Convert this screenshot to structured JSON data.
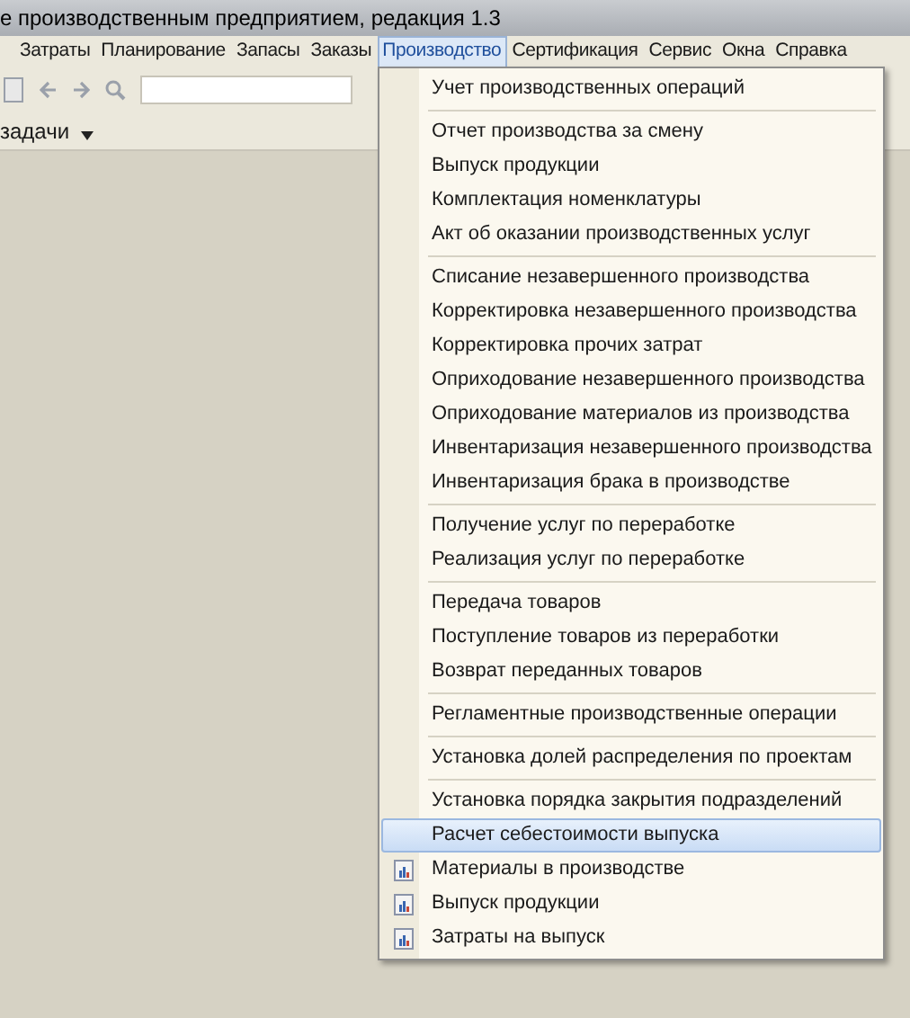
{
  "window": {
    "title": "е производственным предприятием, редакция 1.3"
  },
  "menu_bar": [
    {
      "label": "Затраты",
      "selected": false
    },
    {
      "label": "Планирование",
      "selected": false
    },
    {
      "label": "Запасы",
      "selected": false
    },
    {
      "label": "Заказы",
      "selected": false
    },
    {
      "label": "Производство",
      "selected": true
    },
    {
      "label": "Сертификация",
      "selected": false
    },
    {
      "label": "Сервис",
      "selected": false
    },
    {
      "label": "Окна",
      "selected": false
    },
    {
      "label": "Справка",
      "selected": false
    }
  ],
  "task_bar": {
    "label": "задачи"
  },
  "dropdown": {
    "groups": [
      [
        {
          "label": "Учет производственных операций",
          "kind": "plain",
          "selected": false
        }
      ],
      [
        {
          "label": "Отчет производства за смену",
          "kind": "plain",
          "selected": false
        },
        {
          "label": "Выпуск продукции",
          "kind": "plain",
          "selected": false
        },
        {
          "label": "Комплектация номенклатуры",
          "kind": "plain",
          "selected": false
        },
        {
          "label": "Акт об оказании производственных услуг",
          "kind": "plain",
          "selected": false
        }
      ],
      [
        {
          "label": "Списание незавершенного производства",
          "kind": "plain",
          "selected": false
        },
        {
          "label": "Корректировка незавершенного производства",
          "kind": "plain",
          "selected": false
        },
        {
          "label": "Корректировка прочих затрат",
          "kind": "plain",
          "selected": false
        },
        {
          "label": "Оприходование незавершенного производства",
          "kind": "plain",
          "selected": false
        },
        {
          "label": "Оприходование материалов из производства",
          "kind": "plain",
          "selected": false
        },
        {
          "label": "Инвентаризация незавершенного производства",
          "kind": "plain",
          "selected": false
        },
        {
          "label": "Инвентаризация брака в производстве",
          "kind": "plain",
          "selected": false
        }
      ],
      [
        {
          "label": "Получение услуг по переработке",
          "kind": "plain",
          "selected": false
        },
        {
          "label": "Реализация услуг по переработке",
          "kind": "plain",
          "selected": false
        }
      ],
      [
        {
          "label": "Передача товаров",
          "kind": "plain",
          "selected": false
        },
        {
          "label": "Поступление товаров из переработки",
          "kind": "plain",
          "selected": false
        },
        {
          "label": "Возврат переданных товаров",
          "kind": "plain",
          "selected": false
        }
      ],
      [
        {
          "label": "Регламентные производственные операции",
          "kind": "plain",
          "selected": false
        }
      ],
      [
        {
          "label": "Установка долей распределения по проектам",
          "kind": "plain",
          "selected": false
        }
      ],
      [
        {
          "label": "Установка порядка закрытия подразделений",
          "kind": "plain",
          "selected": false
        },
        {
          "label": "Расчет себестоимости выпуска",
          "kind": "plain",
          "selected": true
        },
        {
          "label": "Материалы в производстве",
          "kind": "report",
          "selected": false
        },
        {
          "label": "Выпуск продукции",
          "kind": "report",
          "selected": false
        },
        {
          "label": "Затраты на выпуск",
          "kind": "report",
          "selected": false
        }
      ]
    ]
  }
}
